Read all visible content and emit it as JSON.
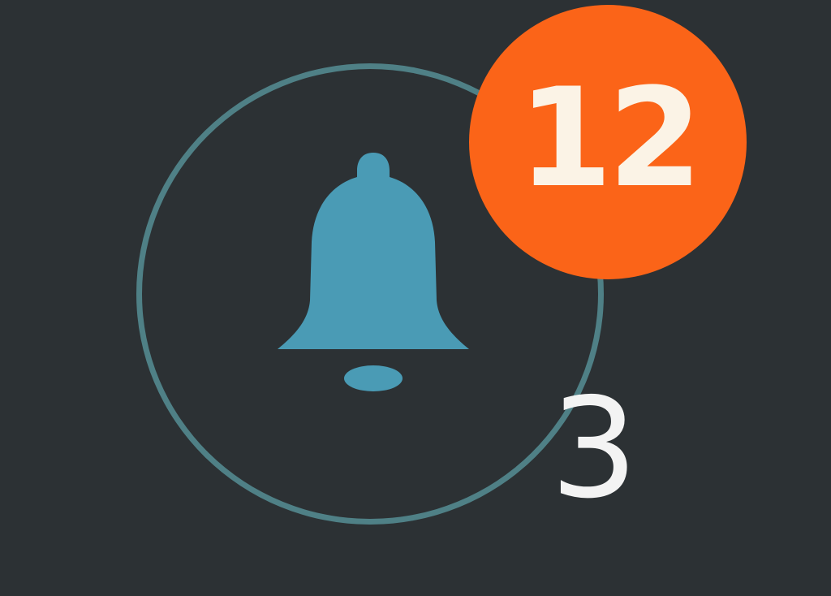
{
  "notifications": {
    "icon": "bell-icon",
    "badge_count": "12",
    "secondary_count": "3"
  },
  "colors": {
    "background": "#2c3134",
    "ring": "#4f8086",
    "bell": "#4a9bb5",
    "badge": "#fb6418",
    "badge_text": "#fbf3e6",
    "secondary_text": "#f3f3f3"
  }
}
